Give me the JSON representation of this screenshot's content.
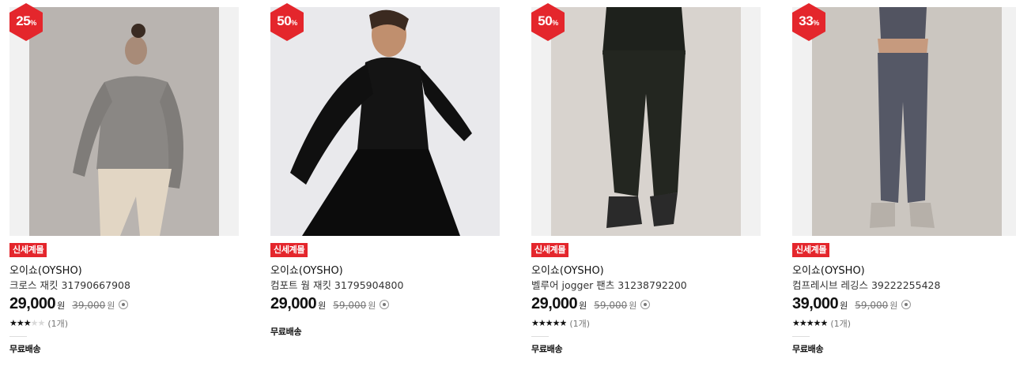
{
  "products": [
    {
      "discount": "25",
      "discount_unit": "%",
      "tag": "신세계몰",
      "brand": "오이쇼(OYSHO)",
      "name": "크로스 재킷 31790667908",
      "price": "29,000",
      "price_unit": "원",
      "original_price": "39,000",
      "original_unit": "원",
      "rating": 3,
      "rating_max": 5,
      "review_count": "(1개)",
      "shipping": "무료배송"
    },
    {
      "discount": "50",
      "discount_unit": "%",
      "tag": "신세계몰",
      "brand": "오이쇼(OYSHO)",
      "name": "컴포트 웜 재킷 31795904800",
      "price": "29,000",
      "price_unit": "원",
      "original_price": "59,000",
      "original_unit": "원",
      "shipping": "무료배송"
    },
    {
      "discount": "50",
      "discount_unit": "%",
      "tag": "신세계몰",
      "brand": "오이쇼(OYSHO)",
      "name": "벨루어 jogger 팬츠 31238792200",
      "price": "29,000",
      "price_unit": "원",
      "original_price": "59,000",
      "original_unit": "원",
      "rating": 5,
      "rating_max": 5,
      "review_count": "(1개)",
      "shipping": "무료배송"
    },
    {
      "discount": "33",
      "discount_unit": "%",
      "tag": "신세계몰",
      "brand": "오이쇼(OYSHO)",
      "name": "컴프레시브 레깅스 39222255428",
      "price": "39,000",
      "price_unit": "원",
      "original_price": "59,000",
      "original_unit": "원",
      "rating": 5,
      "rating_max": 5,
      "review_count": "(1개)",
      "shipping": "무료배송"
    }
  ],
  "colors": {
    "badge": "#e4262c",
    "tag_bg": "#e4262c",
    "image_bg": [
      "#b9b4b0",
      "#e9e9ec",
      "#d8d3ce",
      "#cbc6c0"
    ]
  },
  "icons": {
    "badge_shape": "hexagon",
    "price_info": "info-circle-icon",
    "rating": "star-icon"
  }
}
